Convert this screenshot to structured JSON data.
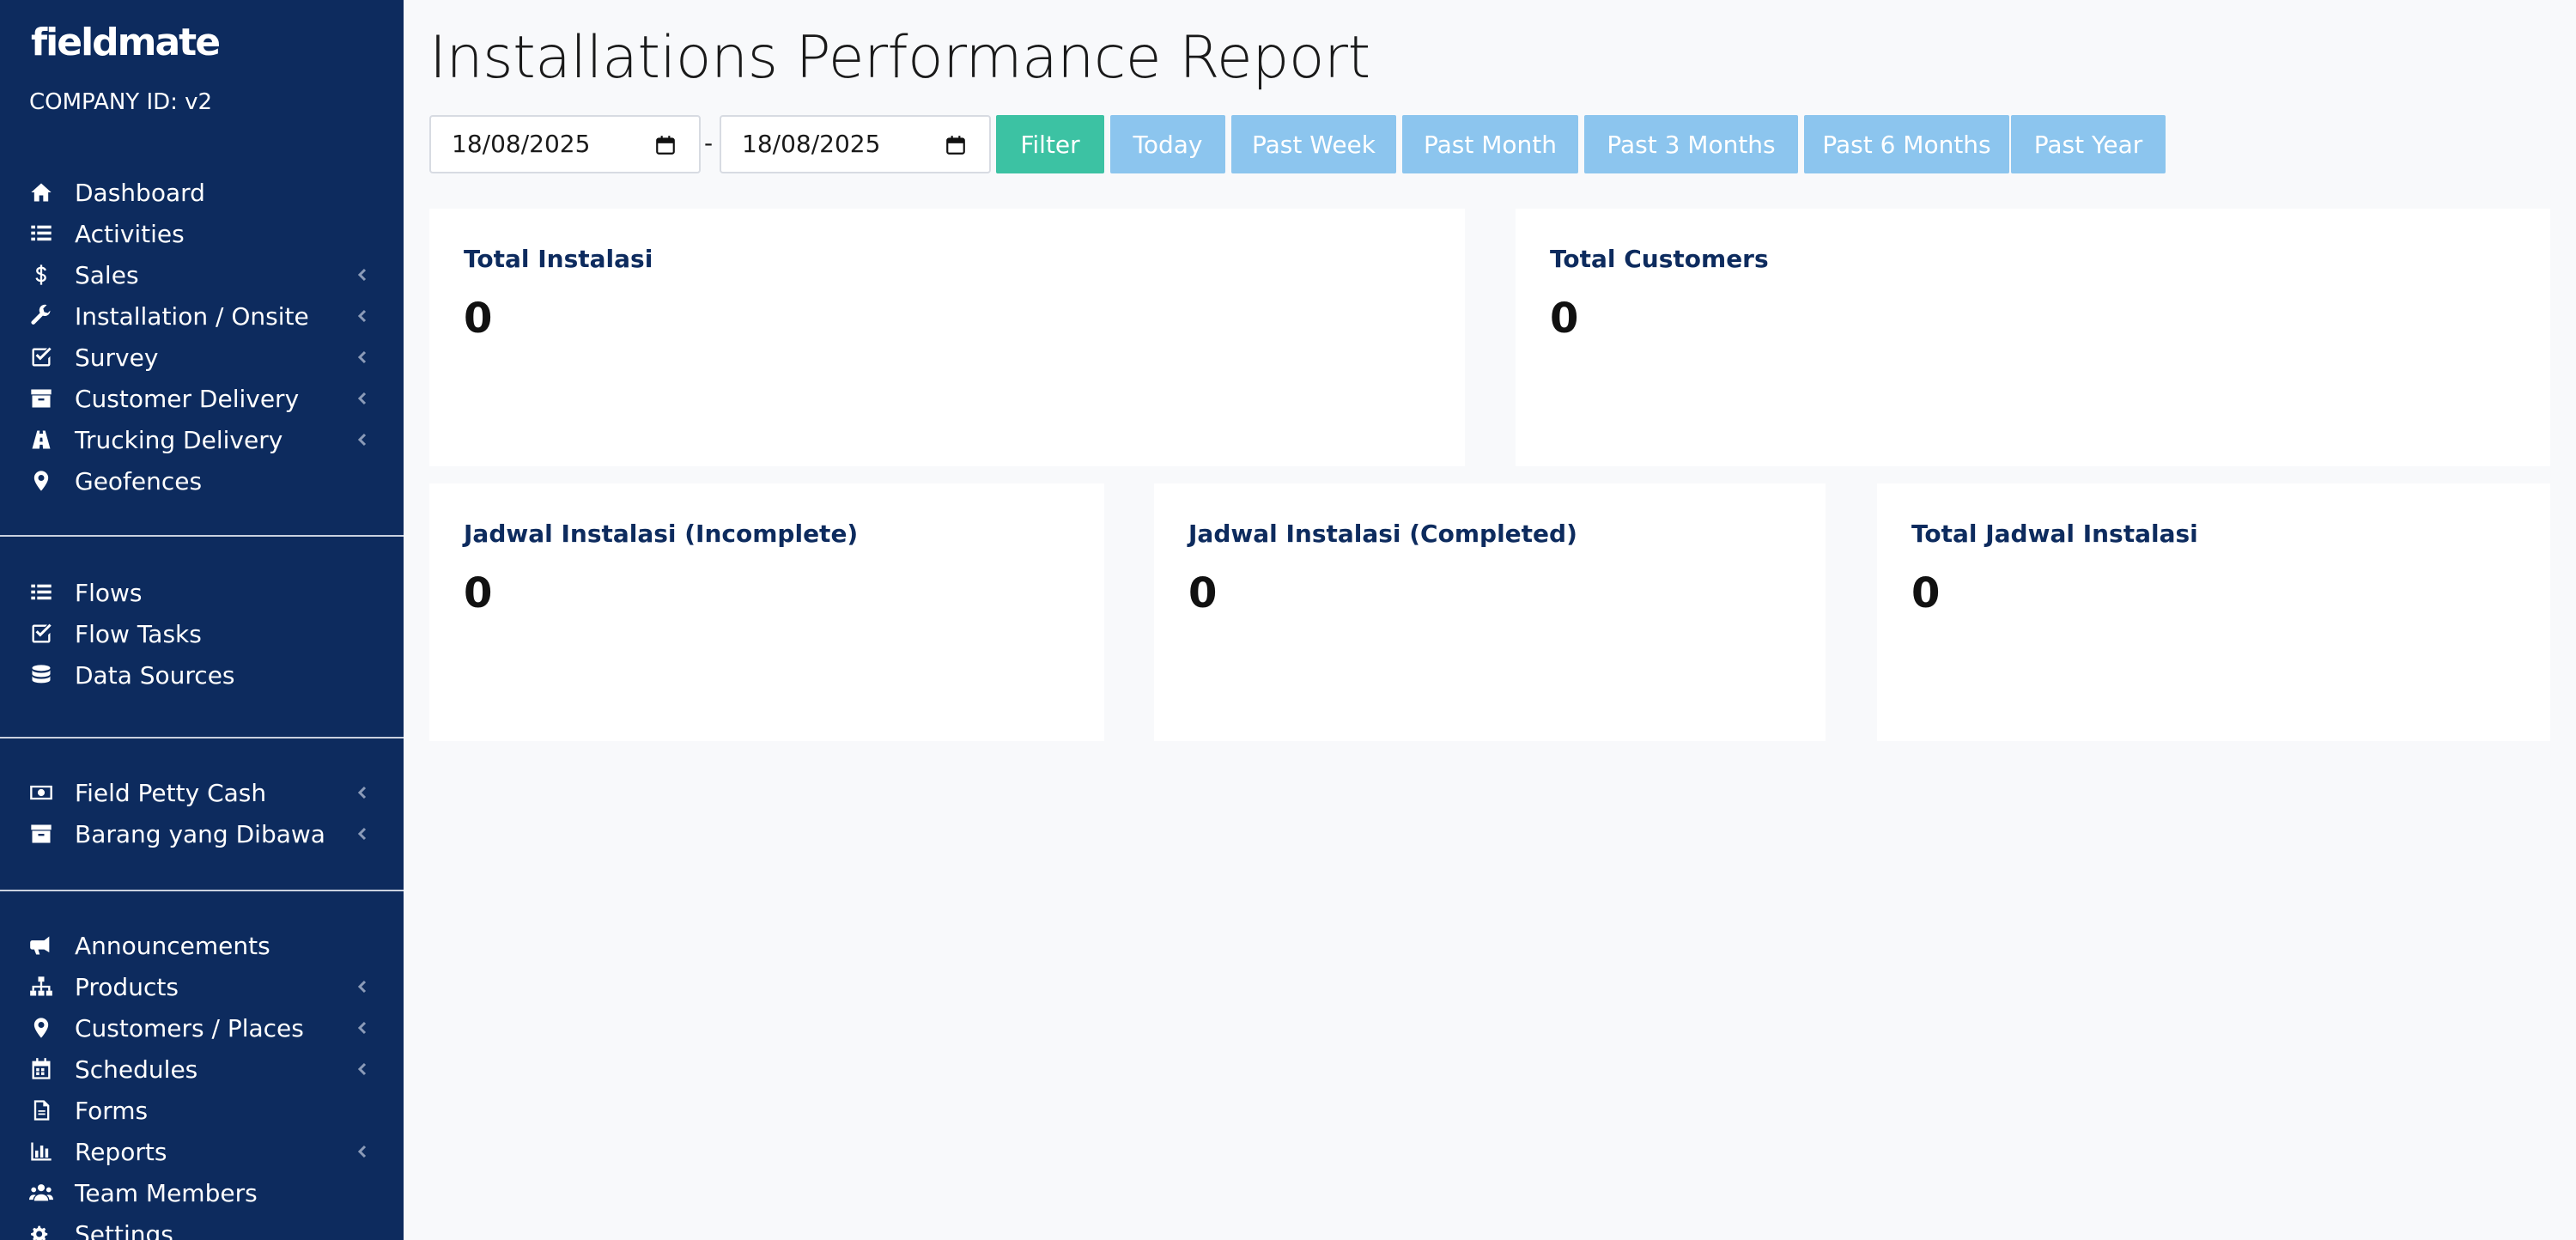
{
  "app": {
    "logo": "fieldmate",
    "company_id": "COMPANY ID: v2"
  },
  "sidebar": {
    "group1": [
      {
        "label": "Dashboard",
        "icon": "home-icon",
        "chevron": false
      },
      {
        "label": "Activities",
        "icon": "list-icon",
        "chevron": false
      },
      {
        "label": "Sales",
        "icon": "dollar-icon",
        "chevron": true
      },
      {
        "label": "Installation / Onsite",
        "icon": "wrench-icon",
        "chevron": true
      },
      {
        "label": "Survey",
        "icon": "check-square-icon",
        "chevron": true
      },
      {
        "label": "Customer Delivery",
        "icon": "archive-icon",
        "chevron": true
      },
      {
        "label": "Trucking Delivery",
        "icon": "road-icon",
        "chevron": true
      },
      {
        "label": "Geofences",
        "icon": "map-marker-icon",
        "chevron": false
      }
    ],
    "group2": [
      {
        "label": "Flows",
        "icon": "list-icon",
        "chevron": false
      },
      {
        "label": "Flow Tasks",
        "icon": "check-square-icon",
        "chevron": false
      },
      {
        "label": "Data Sources",
        "icon": "database-icon",
        "chevron": false
      }
    ],
    "group3": [
      {
        "label": "Field Petty Cash",
        "icon": "money-bill-icon",
        "chevron": true
      },
      {
        "label": "Barang yang Dibawa",
        "icon": "archive-icon",
        "chevron": true
      }
    ],
    "group4": [
      {
        "label": "Announcements",
        "icon": "bullhorn-icon",
        "chevron": false
      },
      {
        "label": "Products",
        "icon": "sitemap-icon",
        "chevron": true
      },
      {
        "label": "Customers / Places",
        "icon": "map-marker-icon",
        "chevron": true
      },
      {
        "label": "Schedules",
        "icon": "calendar-icon",
        "chevron": true
      },
      {
        "label": "Forms",
        "icon": "file-icon",
        "chevron": false
      },
      {
        "label": "Reports",
        "icon": "bar-chart-icon",
        "chevron": true
      },
      {
        "label": "Team Members",
        "icon": "users-icon",
        "chevron": false
      },
      {
        "label": "Settings",
        "icon": "gears-icon",
        "chevron": false
      }
    ]
  },
  "main": {
    "title": "Installations Performance Report",
    "date_from": "18/08/2025",
    "date_to": "18/08/2025",
    "date_separator": "-",
    "buttons": {
      "filter": "Filter",
      "today": "Today",
      "past_week": "Past Week",
      "past_month": "Past Month",
      "past_3_months": "Past 3 Months",
      "past_6_months": "Past 6 Months",
      "past_year": "Past Year"
    },
    "cards": {
      "total_instalasi": {
        "title": "Total Instalasi",
        "value": "0"
      },
      "total_customers": {
        "title": "Total Customers",
        "value": "0"
      },
      "jadwal_incomplete": {
        "title": "Jadwal Instalasi (Incomplete)",
        "value": "0"
      },
      "jadwal_completed": {
        "title": "Jadwal Instalasi (Completed)",
        "value": "0"
      },
      "total_jadwal": {
        "title": "Total Jadwal Instalasi",
        "value": "0"
      }
    }
  },
  "colors": {
    "sidebar_bg": "#0d2b5e",
    "filter_button": "#3cc2a3",
    "range_button": "#8cc5ee",
    "card_title": "#0d2b5e"
  }
}
